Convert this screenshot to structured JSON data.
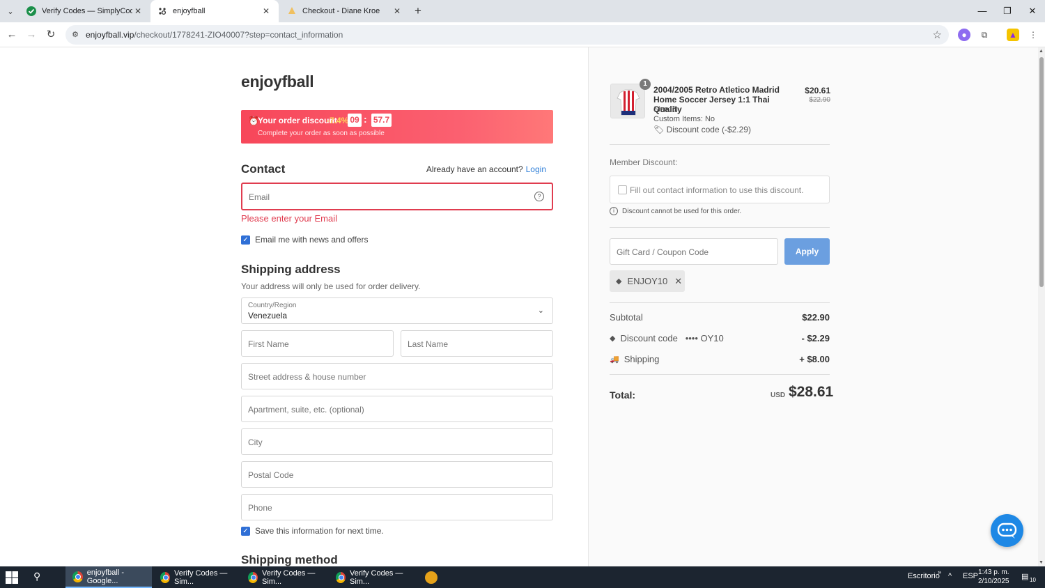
{
  "browser": {
    "tabs": [
      {
        "title": "Verify Codes — SimplyCodes",
        "active": false
      },
      {
        "title": "enjoyfball",
        "active": true
      },
      {
        "title": "Checkout - Diane Kroe",
        "active": false
      }
    ],
    "url_domain": "enjoyfball.vip",
    "url_path": "/checkout/1778241-ZIO40007?step=contact_information"
  },
  "checkout": {
    "brand": "enjoyfball",
    "promo": {
      "title": "Your order discount",
      "percent": "-7.4%",
      "minutes": "09",
      "separator": ":",
      "seconds": "57.7",
      "subtitle": "Complete your order as soon as possible"
    },
    "contact": {
      "heading": "Contact",
      "account_prompt": "Already have an account?",
      "login_label": "Login",
      "email_placeholder": "Email",
      "email_error": "Please enter your Email",
      "news_label": "Email me with news and offers",
      "news_checked": true
    },
    "shipping": {
      "heading": "Shipping address",
      "subtitle": "Your address will only be used for order delivery.",
      "country_label": "Country/Region",
      "country_value": "Venezuela",
      "first_name_placeholder": "First Name",
      "last_name_placeholder": "Last Name",
      "street_placeholder": "Street address & house number",
      "apartment_placeholder": "Apartment, suite, etc. (optional)",
      "city_placeholder": "City",
      "postal_placeholder": "Postal Code",
      "phone_placeholder": "Phone",
      "save_label": "Save this information for next time.",
      "save_checked": true
    },
    "shipping_method_heading": "Shipping method"
  },
  "summary": {
    "product": {
      "quantity": "1",
      "title": "2004/2005 Retro Atletico Madrid Home Soccer Jersey 1:1 Thai Quality",
      "size": "Size: S",
      "custom": "Custom Items: No",
      "discount": "Discount code (-$2.29)",
      "price": "$20.61",
      "original_price": "$22.90"
    },
    "member_discount_label": "Member Discount:",
    "member_discount_text": "Fill out contact information to use this discount.",
    "member_discount_note": "Discount cannot be used for this order.",
    "coupon_placeholder": "Gift Card / Coupon Code",
    "apply_label": "Apply",
    "applied_code": "ENJOY10",
    "subtotal_label": "Subtotal",
    "subtotal_value": "$22.90",
    "discount_label": "Discount code",
    "discount_code_masked": "•••• OY10",
    "discount_value": "- $2.29",
    "shipping_label": "Shipping",
    "shipping_value": "+ $8.00",
    "total_label": "Total:",
    "currency": "USD",
    "total_value": "$28.61"
  },
  "taskbar": {
    "items": [
      {
        "label": "enjoyfball - Google...",
        "active": true
      },
      {
        "label": "Verify Codes — Sim...",
        "active": false
      },
      {
        "label": "Verify Codes — Sim...",
        "active": false
      },
      {
        "label": "Verify Codes — Sim...",
        "active": false
      }
    ],
    "desktop_label": "Escritorio",
    "language": "ESP",
    "time": "1:43 p. m.",
    "date": "2/10/2025",
    "notifications": "10"
  },
  "colors": {
    "accent": "#2f6fd6",
    "error": "#e03c4f",
    "promo": "#f7475a",
    "apply": "#6b9fe0",
    "chat": "#1e88e5"
  }
}
